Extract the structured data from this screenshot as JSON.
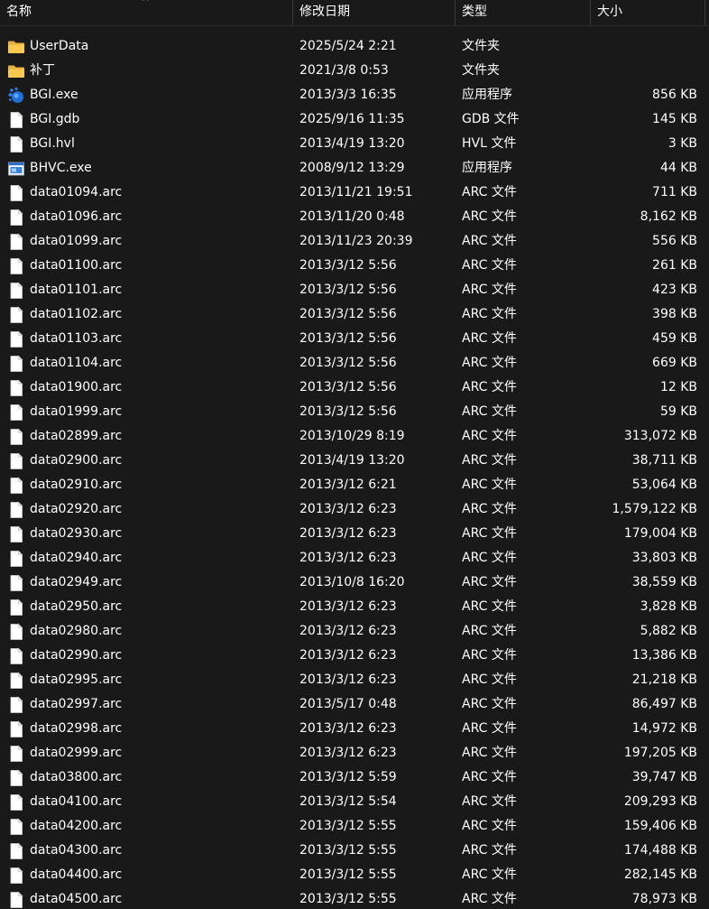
{
  "columns": {
    "name": "名称",
    "date": "修改日期",
    "type": "类型",
    "size": "大小"
  },
  "colors": {
    "background": "#191919",
    "text": "#ffffff",
    "folder": "#f4c64e",
    "file_page": "#ffffff",
    "exe_blue": "#2f7ee0"
  },
  "files": [
    {
      "name": "UserData",
      "date": "2025/5/24 2:21",
      "type": "文件夹",
      "size": "",
      "icon": "folder-icon"
    },
    {
      "name": "补丁",
      "date": "2021/3/8 0:53",
      "type": "文件夹",
      "size": "",
      "icon": "folder-icon"
    },
    {
      "name": "BGI.exe",
      "date": "2013/3/3 16:35",
      "type": "应用程序",
      "size": "856 KB",
      "icon": "bgi-app-icon"
    },
    {
      "name": "BGI.gdb",
      "date": "2025/9/16 11:35",
      "type": "GDB 文件",
      "size": "145 KB",
      "icon": "file-icon"
    },
    {
      "name": "BGI.hvl",
      "date": "2013/4/19 13:20",
      "type": "HVL 文件",
      "size": "3 KB",
      "icon": "file-icon"
    },
    {
      "name": "BHVC.exe",
      "date": "2008/9/12 13:29",
      "type": "应用程序",
      "size": "44 KB",
      "icon": "window-app-icon"
    },
    {
      "name": "data01094.arc",
      "date": "2013/11/21 19:51",
      "type": "ARC 文件",
      "size": "711 KB",
      "icon": "file-icon"
    },
    {
      "name": "data01096.arc",
      "date": "2013/11/20 0:48",
      "type": "ARC 文件",
      "size": "8,162 KB",
      "icon": "file-icon"
    },
    {
      "name": "data01099.arc",
      "date": "2013/11/23 20:39",
      "type": "ARC 文件",
      "size": "556 KB",
      "icon": "file-icon"
    },
    {
      "name": "data01100.arc",
      "date": "2013/3/12 5:56",
      "type": "ARC 文件",
      "size": "261 KB",
      "icon": "file-icon"
    },
    {
      "name": "data01101.arc",
      "date": "2013/3/12 5:56",
      "type": "ARC 文件",
      "size": "423 KB",
      "icon": "file-icon"
    },
    {
      "name": "data01102.arc",
      "date": "2013/3/12 5:56",
      "type": "ARC 文件",
      "size": "398 KB",
      "icon": "file-icon"
    },
    {
      "name": "data01103.arc",
      "date": "2013/3/12 5:56",
      "type": "ARC 文件",
      "size": "459 KB",
      "icon": "file-icon"
    },
    {
      "name": "data01104.arc",
      "date": "2013/3/12 5:56",
      "type": "ARC 文件",
      "size": "669 KB",
      "icon": "file-icon"
    },
    {
      "name": "data01900.arc",
      "date": "2013/3/12 5:56",
      "type": "ARC 文件",
      "size": "12 KB",
      "icon": "file-icon"
    },
    {
      "name": "data01999.arc",
      "date": "2013/3/12 5:56",
      "type": "ARC 文件",
      "size": "59 KB",
      "icon": "file-icon"
    },
    {
      "name": "data02899.arc",
      "date": "2013/10/29 8:19",
      "type": "ARC 文件",
      "size": "313,072 KB",
      "icon": "file-icon"
    },
    {
      "name": "data02900.arc",
      "date": "2013/4/19 13:20",
      "type": "ARC 文件",
      "size": "38,711 KB",
      "icon": "file-icon"
    },
    {
      "name": "data02910.arc",
      "date": "2013/3/12 6:21",
      "type": "ARC 文件",
      "size": "53,064 KB",
      "icon": "file-icon"
    },
    {
      "name": "data02920.arc",
      "date": "2013/3/12 6:23",
      "type": "ARC 文件",
      "size": "1,579,122 KB",
      "icon": "file-icon"
    },
    {
      "name": "data02930.arc",
      "date": "2013/3/12 6:23",
      "type": "ARC 文件",
      "size": "179,004 KB",
      "icon": "file-icon"
    },
    {
      "name": "data02940.arc",
      "date": "2013/3/12 6:23",
      "type": "ARC 文件",
      "size": "33,803 KB",
      "icon": "file-icon"
    },
    {
      "name": "data02949.arc",
      "date": "2013/10/8 16:20",
      "type": "ARC 文件",
      "size": "38,559 KB",
      "icon": "file-icon"
    },
    {
      "name": "data02950.arc",
      "date": "2013/3/12 6:23",
      "type": "ARC 文件",
      "size": "3,828 KB",
      "icon": "file-icon"
    },
    {
      "name": "data02980.arc",
      "date": "2013/3/12 6:23",
      "type": "ARC 文件",
      "size": "5,882 KB",
      "icon": "file-icon"
    },
    {
      "name": "data02990.arc",
      "date": "2013/3/12 6:23",
      "type": "ARC 文件",
      "size": "13,386 KB",
      "icon": "file-icon"
    },
    {
      "name": "data02995.arc",
      "date": "2013/3/12 6:23",
      "type": "ARC 文件",
      "size": "21,218 KB",
      "icon": "file-icon"
    },
    {
      "name": "data02997.arc",
      "date": "2013/5/17 0:48",
      "type": "ARC 文件",
      "size": "86,497 KB",
      "icon": "file-icon"
    },
    {
      "name": "data02998.arc",
      "date": "2013/3/12 6:23",
      "type": "ARC 文件",
      "size": "14,972 KB",
      "icon": "file-icon"
    },
    {
      "name": "data02999.arc",
      "date": "2013/3/12 6:23",
      "type": "ARC 文件",
      "size": "197,205 KB",
      "icon": "file-icon"
    },
    {
      "name": "data03800.arc",
      "date": "2013/3/12 5:59",
      "type": "ARC 文件",
      "size": "39,747 KB",
      "icon": "file-icon"
    },
    {
      "name": "data04100.arc",
      "date": "2013/3/12 5:54",
      "type": "ARC 文件",
      "size": "209,293 KB",
      "icon": "file-icon"
    },
    {
      "name": "data04200.arc",
      "date": "2013/3/12 5:55",
      "type": "ARC 文件",
      "size": "159,406 KB",
      "icon": "file-icon"
    },
    {
      "name": "data04300.arc",
      "date": "2013/3/12 5:55",
      "type": "ARC 文件",
      "size": "174,488 KB",
      "icon": "file-icon"
    },
    {
      "name": "data04400.arc",
      "date": "2013/3/12 5:55",
      "type": "ARC 文件",
      "size": "282,145 KB",
      "icon": "file-icon"
    },
    {
      "name": "data04500.arc",
      "date": "2013/3/12 5:55",
      "type": "ARC 文件",
      "size": "78,973 KB",
      "icon": "file-icon"
    }
  ]
}
